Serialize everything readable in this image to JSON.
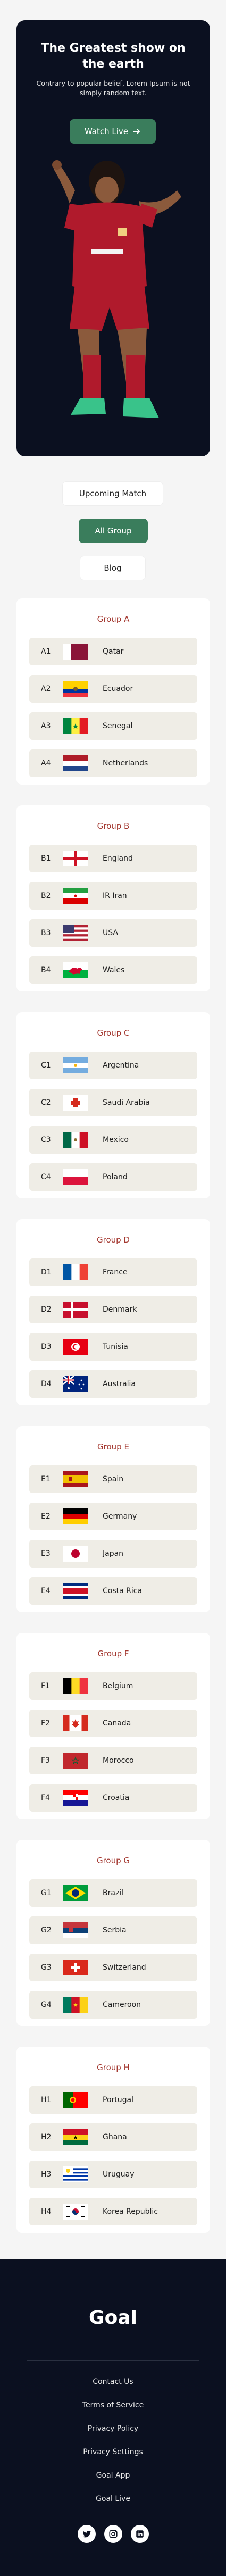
{
  "hero": {
    "title": "The Greatest show on the earth",
    "subtitle": "Contrary to popular belief, Lorem Ipsum is not simply random text.",
    "cta_label": "Watch Live",
    "cta_icon": "arrow-right-icon"
  },
  "tabs": [
    {
      "label": "Upcoming Match",
      "active": false
    },
    {
      "label": "All Group",
      "active": true
    },
    {
      "label": "Blog",
      "active": false
    }
  ],
  "groups": [
    {
      "title": "Group A",
      "teams": [
        {
          "code": "A1",
          "name": "Qatar",
          "flag": "qatar"
        },
        {
          "code": "A2",
          "name": "Ecuador",
          "flag": "ecuador"
        },
        {
          "code": "A3",
          "name": "Senegal",
          "flag": "senegal"
        },
        {
          "code": "A4",
          "name": "Netherlands",
          "flag": "netherlands"
        }
      ]
    },
    {
      "title": "Group B",
      "teams": [
        {
          "code": "B1",
          "name": "England",
          "flag": "england"
        },
        {
          "code": "B2",
          "name": "IR Iran",
          "flag": "iran"
        },
        {
          "code": "B3",
          "name": "USA",
          "flag": "usa"
        },
        {
          "code": "B4",
          "name": "Wales",
          "flag": "wales"
        }
      ]
    },
    {
      "title": "Group C",
      "teams": [
        {
          "code": "C1",
          "name": "Argentina",
          "flag": "argentina"
        },
        {
          "code": "C2",
          "name": "Saudi Arabia",
          "flag": "saudi-arabia"
        },
        {
          "code": "C3",
          "name": "Mexico",
          "flag": "mexico"
        },
        {
          "code": "C4",
          "name": "Poland",
          "flag": "poland"
        }
      ]
    },
    {
      "title": "Group D",
      "teams": [
        {
          "code": "D1",
          "name": "France",
          "flag": "france"
        },
        {
          "code": "D2",
          "name": "Denmark",
          "flag": "denmark"
        },
        {
          "code": "D3",
          "name": "Tunisia",
          "flag": "tunisia"
        },
        {
          "code": "D4",
          "name": "Australia",
          "flag": "australia"
        }
      ]
    },
    {
      "title": "Group E",
      "teams": [
        {
          "code": "E1",
          "name": "Spain",
          "flag": "spain"
        },
        {
          "code": "E2",
          "name": "Germany",
          "flag": "germany"
        },
        {
          "code": "E3",
          "name": "Japan",
          "flag": "japan"
        },
        {
          "code": "E4",
          "name": "Costa Rica",
          "flag": "costa-rica"
        }
      ]
    },
    {
      "title": "Group F",
      "teams": [
        {
          "code": "F1",
          "name": "Belgium",
          "flag": "belgium"
        },
        {
          "code": "F2",
          "name": "Canada",
          "flag": "canada"
        },
        {
          "code": "F3",
          "name": "Morocco",
          "flag": "morocco"
        },
        {
          "code": "F4",
          "name": "Croatia",
          "flag": "croatia"
        }
      ]
    },
    {
      "title": "Group G",
      "teams": [
        {
          "code": "G1",
          "name": "Brazil",
          "flag": "brazil"
        },
        {
          "code": "G2",
          "name": "Serbia",
          "flag": "serbia"
        },
        {
          "code": "G3",
          "name": "Switzerland",
          "flag": "switzerland"
        },
        {
          "code": "G4",
          "name": "Cameroon",
          "flag": "cameroon"
        }
      ]
    },
    {
      "title": "Group H",
      "teams": [
        {
          "code": "H1",
          "name": "Portugal",
          "flag": "portugal"
        },
        {
          "code": "H2",
          "name": "Ghana",
          "flag": "ghana"
        },
        {
          "code": "H3",
          "name": "Uruguay",
          "flag": "uruguay"
        },
        {
          "code": "H4",
          "name": "Korea Republic",
          "flag": "korea-republic"
        }
      ]
    }
  ],
  "footer": {
    "brand": "Goal",
    "links": [
      "Contact Us",
      "Terms of Service",
      "Privacy Policy",
      "Privacy Settings",
      "Goal App",
      "Goal Live"
    ],
    "socials": [
      "twitter-icon",
      "instagram-icon",
      "linkedin-icon"
    ]
  },
  "colors": {
    "accent": "#3a7d5c",
    "group_title": "#a3372f",
    "dark_bg": "#0b1020",
    "row_bg": "#efede6"
  }
}
